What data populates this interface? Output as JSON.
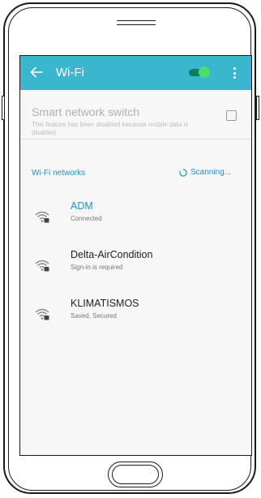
{
  "appbar": {
    "title": "Wi-Fi",
    "back_icon": "arrow-left-icon",
    "more_icon": "more-vert-icon",
    "toggle_on": true,
    "accent_color": "#3bb6cf"
  },
  "smart_switch": {
    "title": "Smart network switch",
    "description": "This feature has been disabled because mobile data is disabled.",
    "checked": false
  },
  "networks_section": {
    "label": "Wi-Fi networks",
    "scanning_label": "Scanning...",
    "scanning_icon": "spinner-icon"
  },
  "networks": [
    {
      "name": "ADM",
      "status": "Connected",
      "icon": "wifi-lock-icon"
    },
    {
      "name": "Delta-AirCondition",
      "status": "Sign-in is required",
      "icon": "wifi-lock-icon"
    },
    {
      "name": "KLIMATISMOS",
      "status": "Saved, Secured",
      "icon": "wifi-lock-icon"
    }
  ]
}
